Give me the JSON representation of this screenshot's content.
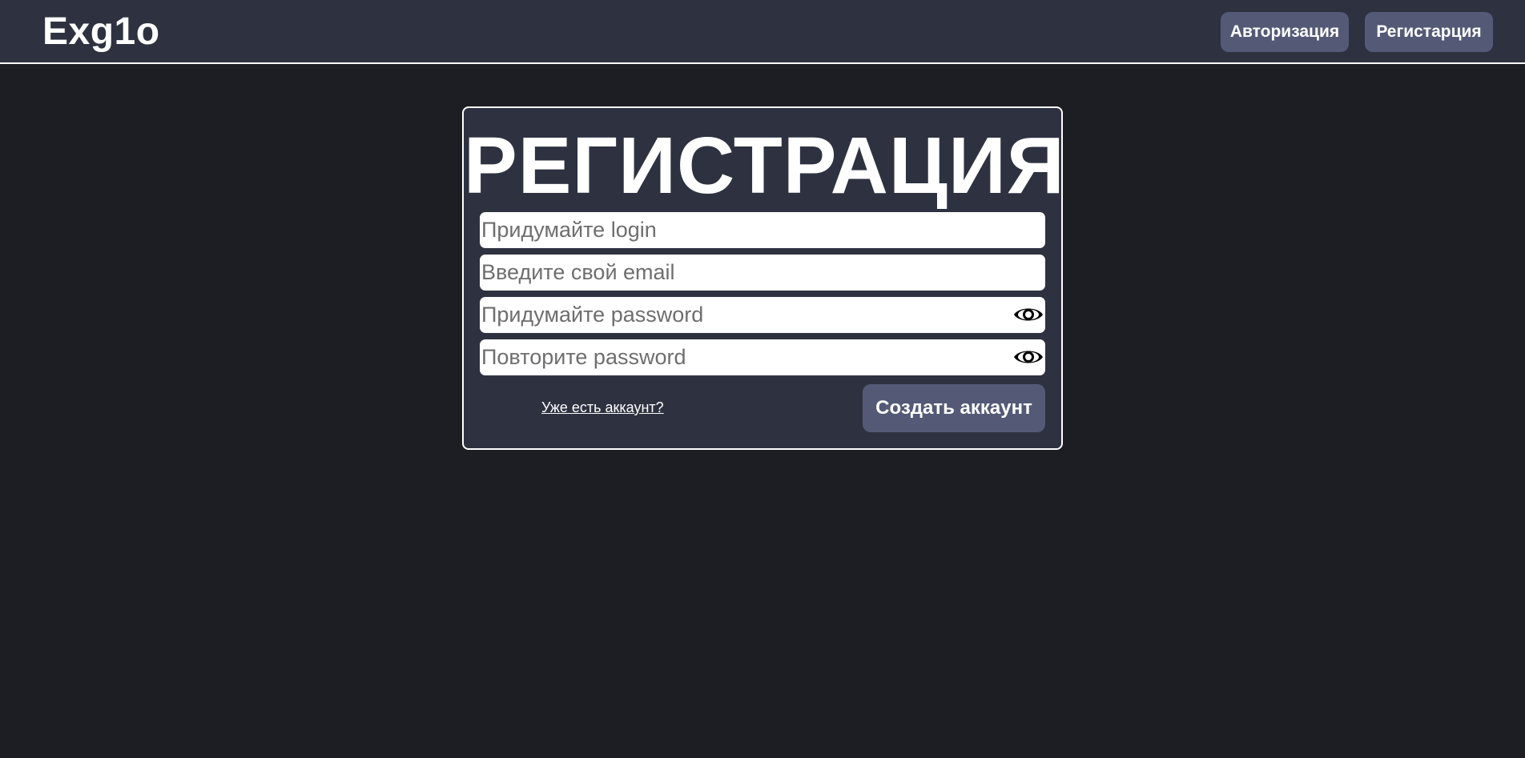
{
  "header": {
    "logo": "Exg1o",
    "nav": {
      "login_label": "Авторизация",
      "register_label": "Регистарция"
    }
  },
  "form": {
    "title": "РЕГИСТРАЦИЯ",
    "login": {
      "placeholder": "Придумайте login",
      "value": ""
    },
    "email": {
      "placeholder": "Введите свой email",
      "value": ""
    },
    "password": {
      "placeholder": "Придумайте password",
      "value": "",
      "toggle_icon": "eye-icon"
    },
    "password_repeat": {
      "placeholder": "Повторите password",
      "value": "",
      "toggle_icon": "eye-icon"
    },
    "already_link": "Уже есть аккаунт?",
    "submit_label": "Создать аккаунт"
  },
  "colors": {
    "page_bg": "#1d1e23",
    "panel_bg": "#2e3240",
    "button_bg": "#545a76",
    "text": "#ffffff"
  }
}
